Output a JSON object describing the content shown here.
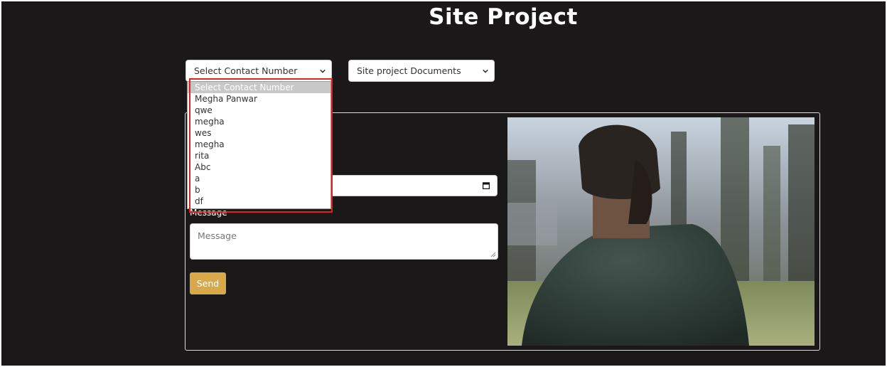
{
  "page": {
    "title": "Site Project"
  },
  "contact_select": {
    "value": "Select Contact Number",
    "options": [
      "Select Contact Number",
      "Megha Panwar",
      "qwe",
      "megha",
      "wes",
      "megha",
      "rita",
      "Abc",
      "a",
      "b",
      "df"
    ],
    "highlighted_index": 0
  },
  "docs_select": {
    "value": "Site project Documents"
  },
  "form": {
    "message_label": "Message",
    "message_placeholder": "Message",
    "send_label": "Send"
  },
  "icons": {
    "contact_chevron": "chevron-down-icon",
    "docs_chevron": "chevron-down-icon",
    "date_picker": "calendar-icon"
  },
  "colors": {
    "background": "#1a1818",
    "send_button": "#d9a848",
    "highlight_border": "#e0201d",
    "selected_option": "#c8c8c8"
  }
}
